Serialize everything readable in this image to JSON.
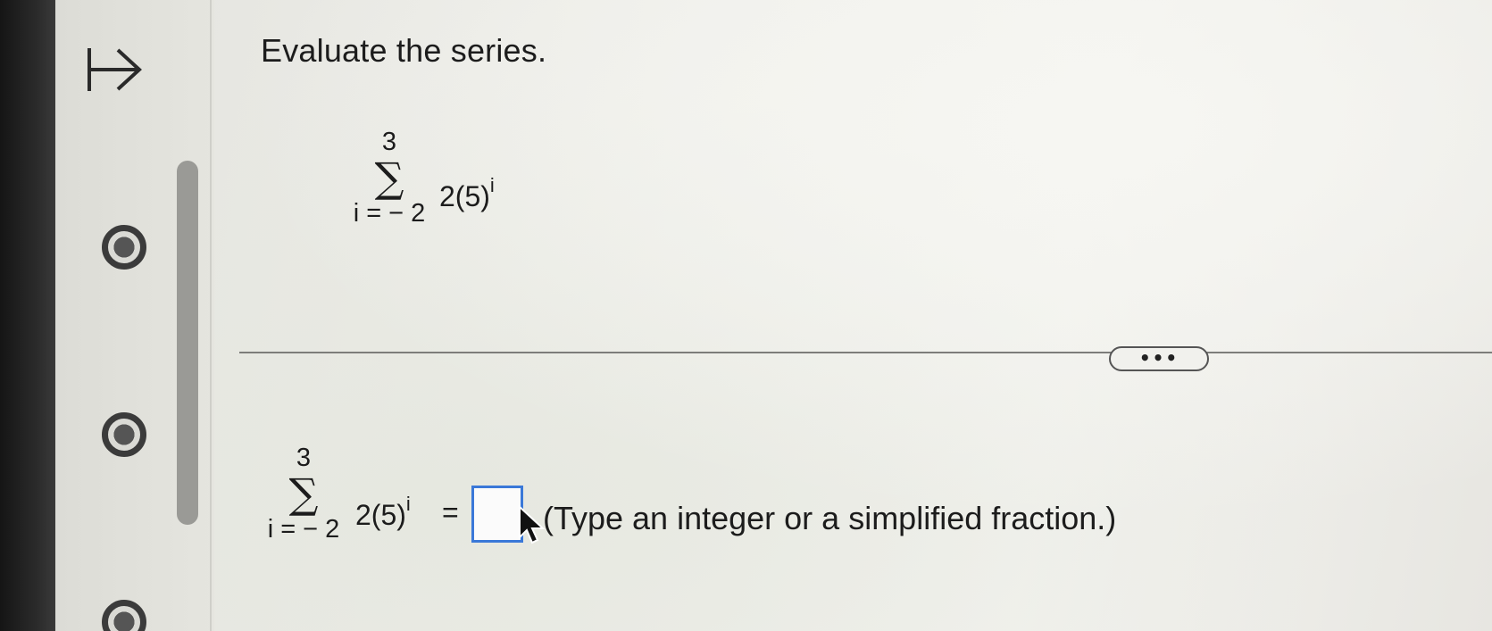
{
  "question": {
    "prompt": "Evaluate the series."
  },
  "series": {
    "upper_limit": "3",
    "sigma_symbol": "∑",
    "lower_limit": "i = − 2",
    "term_base": "2(5)",
    "term_exponent": "i"
  },
  "divider": {
    "more_label": "•••"
  },
  "answer": {
    "upper_limit": "3",
    "sigma_symbol": "∑",
    "lower_limit": "i = − 2",
    "term_base": "2(5)",
    "term_exponent": "i",
    "equals": "=",
    "input_value": "",
    "hint": "(Type an integer or a simplified fraction.)"
  },
  "icons": {
    "nav": "arrow-right-to-bar-icon",
    "pointer": "mouse-cursor-icon",
    "radio": "radio-button-icon"
  },
  "colors": {
    "input_border": "#3a78d8",
    "text": "#1c1c1c"
  }
}
